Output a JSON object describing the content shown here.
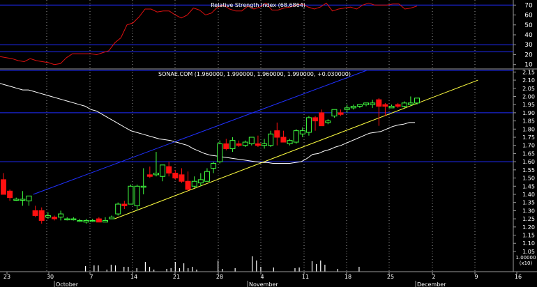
{
  "colors": {
    "background": "#000000",
    "grid": "#9a9a9a",
    "blue": "#1f2cff",
    "rsi": "#e01010",
    "ma": "#ffffff",
    "trend_upper": "#2030ff",
    "trend_lower": "#ffff40",
    "bull_fill": "#000000",
    "bull_edge": "#40ff40",
    "bear": "#ff1010",
    "volume": "#ffffff",
    "text": "#ffffff"
  },
  "chart_data": [
    {
      "type": "line",
      "title": "Relative Strength Index (68.6864)",
      "ylim": [
        7,
        73
      ],
      "yticks": [
        10,
        20,
        30,
        40,
        50,
        60,
        70
      ],
      "hlines": [
        70,
        30,
        23
      ],
      "series": [
        {
          "values": [
            18,
            17,
            16,
            14,
            13,
            16,
            14,
            13,
            12,
            10,
            11,
            17,
            21,
            21,
            21,
            21,
            20,
            22,
            24,
            32,
            37,
            50,
            52,
            58,
            66,
            66,
            63,
            64,
            64,
            60,
            57,
            60,
            67,
            65,
            60,
            62,
            68,
            70,
            66,
            64,
            64,
            69,
            66,
            68,
            72,
            65,
            65,
            67,
            68,
            70,
            71,
            68,
            66,
            68,
            72,
            64,
            66,
            67,
            68,
            66,
            70,
            72,
            70,
            70,
            70,
            71,
            71,
            66,
            67,
            69
          ]
        }
      ]
    },
    {
      "type": "candlestick",
      "title": "SONAE.COM (1.960000, 1.990000, 1.960000, 1.990000, +0.030000)",
      "ylim": [
        0.99,
        2.16
      ],
      "yticks": [
        "2.15",
        "2.10",
        "2.05",
        "2.00",
        "1.95",
        "1.90",
        "1.85",
        "1.80",
        "1.75",
        "1.70",
        "1.65",
        "1.60",
        "1.55",
        "1.50",
        "1.45",
        "1.40",
        "1.35",
        "1.30",
        "1.25",
        "1.20",
        "1.15",
        "1.10",
        "1.05"
      ],
      "hlines": [
        2.16,
        1.9,
        1.6
      ],
      "x_labels": [
        "23",
        "30",
        "7",
        "14",
        "21",
        "28",
        "4",
        "11",
        "18",
        "25",
        "2",
        "9",
        "16"
      ],
      "month_labels": [
        "October",
        "November",
        "December"
      ],
      "volume_label": "1.00000",
      "volume_label2": "(x10)",
      "candles": [
        {
          "o": 1.49,
          "h": 1.53,
          "l": 1.4,
          "c": 1.4
        },
        {
          "o": 1.42,
          "h": 1.43,
          "l": 1.36,
          "c": 1.38
        },
        {
          "o": 1.37,
          "h": 1.38,
          "l": 1.36,
          "c": 1.37
        },
        {
          "o": 1.37,
          "h": 1.42,
          "l": 1.33,
          "c": 1.37
        },
        {
          "o": 1.36,
          "h": 1.39,
          "l": 1.33,
          "c": 1.39
        },
        {
          "o": 1.3,
          "h": 1.33,
          "l": 1.26,
          "c": 1.27
        },
        {
          "o": 1.3,
          "h": 1.32,
          "l": 1.22,
          "c": 1.24
        },
        {
          "o": 1.26,
          "h": 1.29,
          "l": 1.25,
          "c": 1.27
        },
        {
          "o": 1.26,
          "h": 1.27,
          "l": 1.24,
          "c": 1.25
        },
        {
          "o": 1.26,
          "h": 1.3,
          "l": 1.24,
          "c": 1.28
        },
        {
          "o": 1.25,
          "h": 1.26,
          "l": 1.24,
          "c": 1.25
        },
        {
          "o": 1.25,
          "h": 1.26,
          "l": 1.24,
          "c": 1.25
        },
        {
          "o": 1.24,
          "h": 1.25,
          "l": 1.23,
          "c": 1.24
        },
        {
          "o": 1.23,
          "h": 1.25,
          "l": 1.22,
          "c": 1.24
        },
        {
          "o": 1.24,
          "h": 1.25,
          "l": 1.23,
          "c": 1.24
        },
        {
          "o": 1.25,
          "h": 1.26,
          "l": 1.23,
          "c": 1.23
        },
        {
          "o": 1.23,
          "h": 1.26,
          "l": 1.23,
          "c": 1.24
        },
        {
          "o": 1.25,
          "h": 1.27,
          "l": 1.25,
          "c": 1.26
        },
        {
          "o": 1.28,
          "h": 1.35,
          "l": 1.27,
          "c": 1.34
        },
        {
          "o": 1.34,
          "h": 1.36,
          "l": 1.31,
          "c": 1.33
        },
        {
          "o": 1.34,
          "h": 1.46,
          "l": 1.34,
          "c": 1.45
        },
        {
          "o": 1.33,
          "h": 1.46,
          "l": 1.3,
          "c": 1.45
        },
        {
          "o": 1.45,
          "h": 1.56,
          "l": 1.4,
          "c": 1.45
        },
        {
          "o": 1.52,
          "h": 1.57,
          "l": 1.5,
          "c": 1.51
        },
        {
          "o": 1.52,
          "h": 1.66,
          "l": 1.51,
          "c": 1.53
        },
        {
          "o": 1.51,
          "h": 1.58,
          "l": 1.48,
          "c": 1.58
        },
        {
          "o": 1.57,
          "h": 1.6,
          "l": 1.51,
          "c": 1.53
        },
        {
          "o": 1.53,
          "h": 1.55,
          "l": 1.49,
          "c": 1.5
        },
        {
          "o": 1.52,
          "h": 1.56,
          "l": 1.47,
          "c": 1.48
        },
        {
          "o": 1.48,
          "h": 1.54,
          "l": 1.42,
          "c": 1.43
        },
        {
          "o": 1.45,
          "h": 1.51,
          "l": 1.44,
          "c": 1.48
        },
        {
          "o": 1.47,
          "h": 1.53,
          "l": 1.45,
          "c": 1.49
        },
        {
          "o": 1.48,
          "h": 1.56,
          "l": 1.48,
          "c": 1.54
        },
        {
          "o": 1.56,
          "h": 1.6,
          "l": 1.53,
          "c": 1.59
        },
        {
          "o": 1.6,
          "h": 1.73,
          "l": 1.59,
          "c": 1.71
        },
        {
          "o": 1.71,
          "h": 1.74,
          "l": 1.67,
          "c": 1.68
        },
        {
          "o": 1.68,
          "h": 1.75,
          "l": 1.66,
          "c": 1.73
        },
        {
          "o": 1.71,
          "h": 1.73,
          "l": 1.69,
          "c": 1.7
        },
        {
          "o": 1.7,
          "h": 1.73,
          "l": 1.69,
          "c": 1.72
        },
        {
          "o": 1.71,
          "h": 1.75,
          "l": 1.7,
          "c": 1.75
        },
        {
          "o": 1.71,
          "h": 1.76,
          "l": 1.69,
          "c": 1.7
        },
        {
          "o": 1.7,
          "h": 1.74,
          "l": 1.68,
          "c": 1.71
        },
        {
          "o": 1.7,
          "h": 1.79,
          "l": 1.69,
          "c": 1.77
        },
        {
          "o": 1.79,
          "h": 1.84,
          "l": 1.7,
          "c": 1.75
        },
        {
          "o": 1.75,
          "h": 1.79,
          "l": 1.72,
          "c": 1.72
        },
        {
          "o": 1.71,
          "h": 1.74,
          "l": 1.7,
          "c": 1.73
        },
        {
          "o": 1.72,
          "h": 1.8,
          "l": 1.71,
          "c": 1.79
        },
        {
          "o": 1.77,
          "h": 1.81,
          "l": 1.75,
          "c": 1.79
        },
        {
          "o": 1.78,
          "h": 1.88,
          "l": 1.76,
          "c": 1.87
        },
        {
          "o": 1.87,
          "h": 1.88,
          "l": 1.79,
          "c": 1.85
        },
        {
          "o": 1.9,
          "h": 1.92,
          "l": 1.82,
          "c": 1.82
        },
        {
          "o": 1.84,
          "h": 1.86,
          "l": 1.83,
          "c": 1.85
        },
        {
          "o": 1.88,
          "h": 1.92,
          "l": 1.87,
          "c": 1.92
        },
        {
          "o": 1.9,
          "h": 1.92,
          "l": 1.88,
          "c": 1.89
        },
        {
          "o": 1.92,
          "h": 1.95,
          "l": 1.9,
          "c": 1.93
        },
        {
          "o": 1.93,
          "h": 1.95,
          "l": 1.92,
          "c": 1.94
        },
        {
          "o": 1.94,
          "h": 1.95,
          "l": 1.93,
          "c": 1.95
        },
        {
          "o": 1.95,
          "h": 1.96,
          "l": 1.94,
          "c": 1.96
        },
        {
          "o": 1.95,
          "h": 1.98,
          "l": 1.93,
          "c": 1.96
        },
        {
          "o": 1.98,
          "h": 1.99,
          "l": 1.82,
          "c": 1.94
        },
        {
          "o": 1.95,
          "h": 1.96,
          "l": 1.88,
          "c": 1.94
        },
        {
          "o": 1.93,
          "h": 1.95,
          "l": 1.93,
          "c": 1.94
        },
        {
          "o": 1.95,
          "h": 1.96,
          "l": 1.93,
          "c": 1.94
        },
        {
          "o": 1.94,
          "h": 1.97,
          "l": 1.93,
          "c": 1.96
        },
        {
          "o": 1.95,
          "h": 2.0,
          "l": 1.94,
          "c": 1.96
        },
        {
          "o": 1.96,
          "h": 1.99,
          "l": 1.95,
          "c": 1.99
        }
      ],
      "ma": [
        2.08,
        2.07,
        2.06,
        2.05,
        2.04,
        2.04,
        2.03,
        2.02,
        2.01,
        2.0,
        1.99,
        1.98,
        1.97,
        1.96,
        1.95,
        1.94,
        1.92,
        1.91,
        1.89,
        1.87,
        1.85,
        1.83,
        1.81,
        1.79,
        1.78,
        1.77,
        1.76,
        1.75,
        1.74,
        1.735,
        1.73,
        1.72,
        1.71,
        1.7,
        1.68,
        1.665,
        1.65,
        1.64,
        1.635,
        1.63,
        1.625,
        1.62,
        1.615,
        1.61,
        1.605,
        1.6,
        1.595,
        1.595,
        1.59,
        1.59,
        1.59,
        1.59,
        1.595,
        1.6,
        1.62,
        1.645,
        1.65,
        1.665,
        1.675,
        1.69,
        1.7,
        1.715,
        1.73,
        1.745,
        1.76,
        1.775,
        1.78,
        1.785,
        1.8,
        1.815,
        1.825,
        1.83,
        1.84,
        1.84
      ],
      "trend_upper": {
        "from": [
          6,
          1.4
        ],
        "to": [
          84,
          2.16
        ]
      },
      "trend_lower": {
        "from": [
          25,
          1.25
        ],
        "to": [
          110,
          2.1
        ]
      },
      "volume": [
        0,
        0,
        0,
        0,
        0,
        0,
        0,
        0,
        0,
        0,
        0,
        0,
        0,
        0,
        0,
        0,
        0,
        0,
        0,
        0,
        8,
        0,
        9,
        9,
        0,
        3,
        10,
        9,
        0,
        7,
        7,
        0,
        5,
        0,
        14,
        7,
        3,
        0,
        0,
        4,
        5,
        14,
        5,
        12,
        5,
        7,
        3,
        0,
        0,
        0,
        0,
        16,
        4,
        0,
        0,
        5,
        0,
        0,
        0,
        22,
        16,
        7,
        0,
        0,
        6,
        0,
        0,
        0,
        0,
        5,
        6,
        0,
        0,
        15,
        11,
        16,
        10,
        0,
        0,
        4,
        0,
        0,
        0,
        0,
        7,
        0,
        0,
        0,
        0,
        0,
        0,
        0,
        0,
        0,
        0,
        0,
        0,
        0
      ]
    }
  ]
}
